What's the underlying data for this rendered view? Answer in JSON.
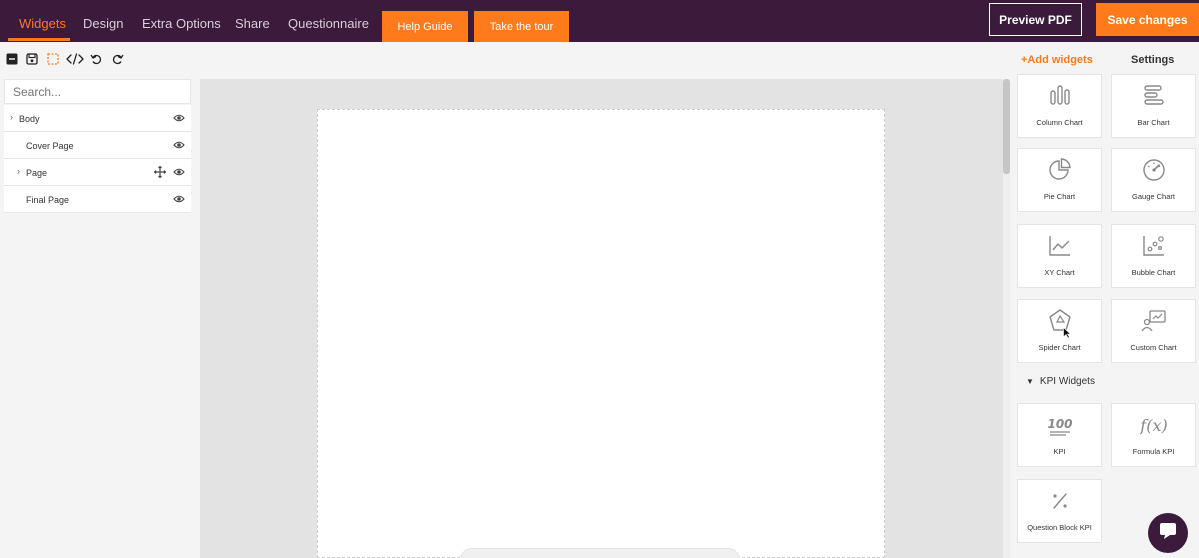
{
  "topbar": {
    "tabs": [
      "Widgets",
      "Design",
      "Extra Options",
      "Share",
      "Questionnaire"
    ],
    "help_guide": "Help Guide",
    "take_tour": "Take the tour",
    "preview_pdf": "Preview PDF",
    "save_changes": "Save changes"
  },
  "toolbar": {
    "icons": [
      "collapse-icon",
      "save-icon",
      "select-icon",
      "code-icon",
      "undo-icon",
      "redo-icon"
    ]
  },
  "left": {
    "search_placeholder": "Search...",
    "tree": [
      {
        "label": "Body",
        "expandable": true
      },
      {
        "label": "Cover Page",
        "expandable": false
      },
      {
        "label": "Page",
        "expandable": true
      },
      {
        "label": "Final Page",
        "expandable": false
      }
    ]
  },
  "right": {
    "add_widgets": "+Add widgets",
    "settings": "Settings",
    "charts": [
      "Column Chart",
      "Bar Chart",
      "Pie Chart",
      "Gauge Chart",
      "XY Chart",
      "Bubble Chart",
      "Spider Chart",
      "Custom Chart"
    ],
    "kpi_section": "KPI Widgets",
    "kpi": [
      "KPI",
      "Formula KPI",
      "Question Block KPI"
    ]
  },
  "colors": {
    "brand": "#3b1a3c",
    "accent": "#ff7a1a"
  }
}
